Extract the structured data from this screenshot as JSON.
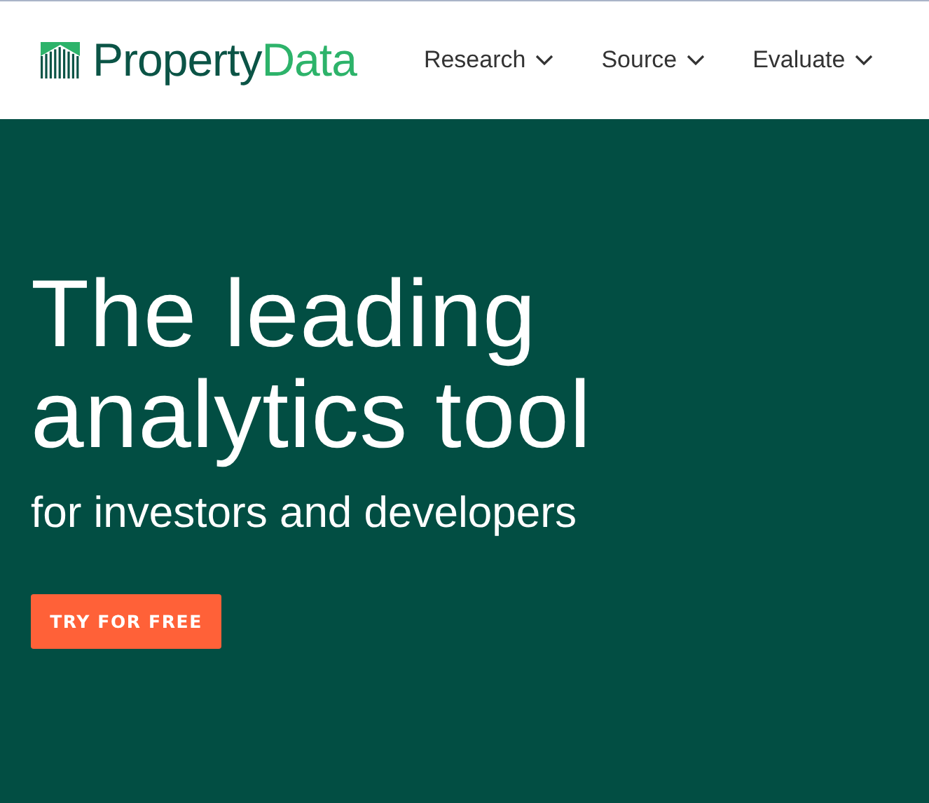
{
  "logo": {
    "primary": "Property",
    "secondary": "Data"
  },
  "nav": [
    {
      "label": "Research",
      "has_dropdown": true
    },
    {
      "label": "Source",
      "has_dropdown": true
    },
    {
      "label": "Evaluate",
      "has_dropdown": true
    }
  ],
  "hero": {
    "title_lines": [
      "The leading",
      "analytics tool"
    ],
    "subtitle": "for investors and developers",
    "cta": "TRY FOR FREE"
  }
}
